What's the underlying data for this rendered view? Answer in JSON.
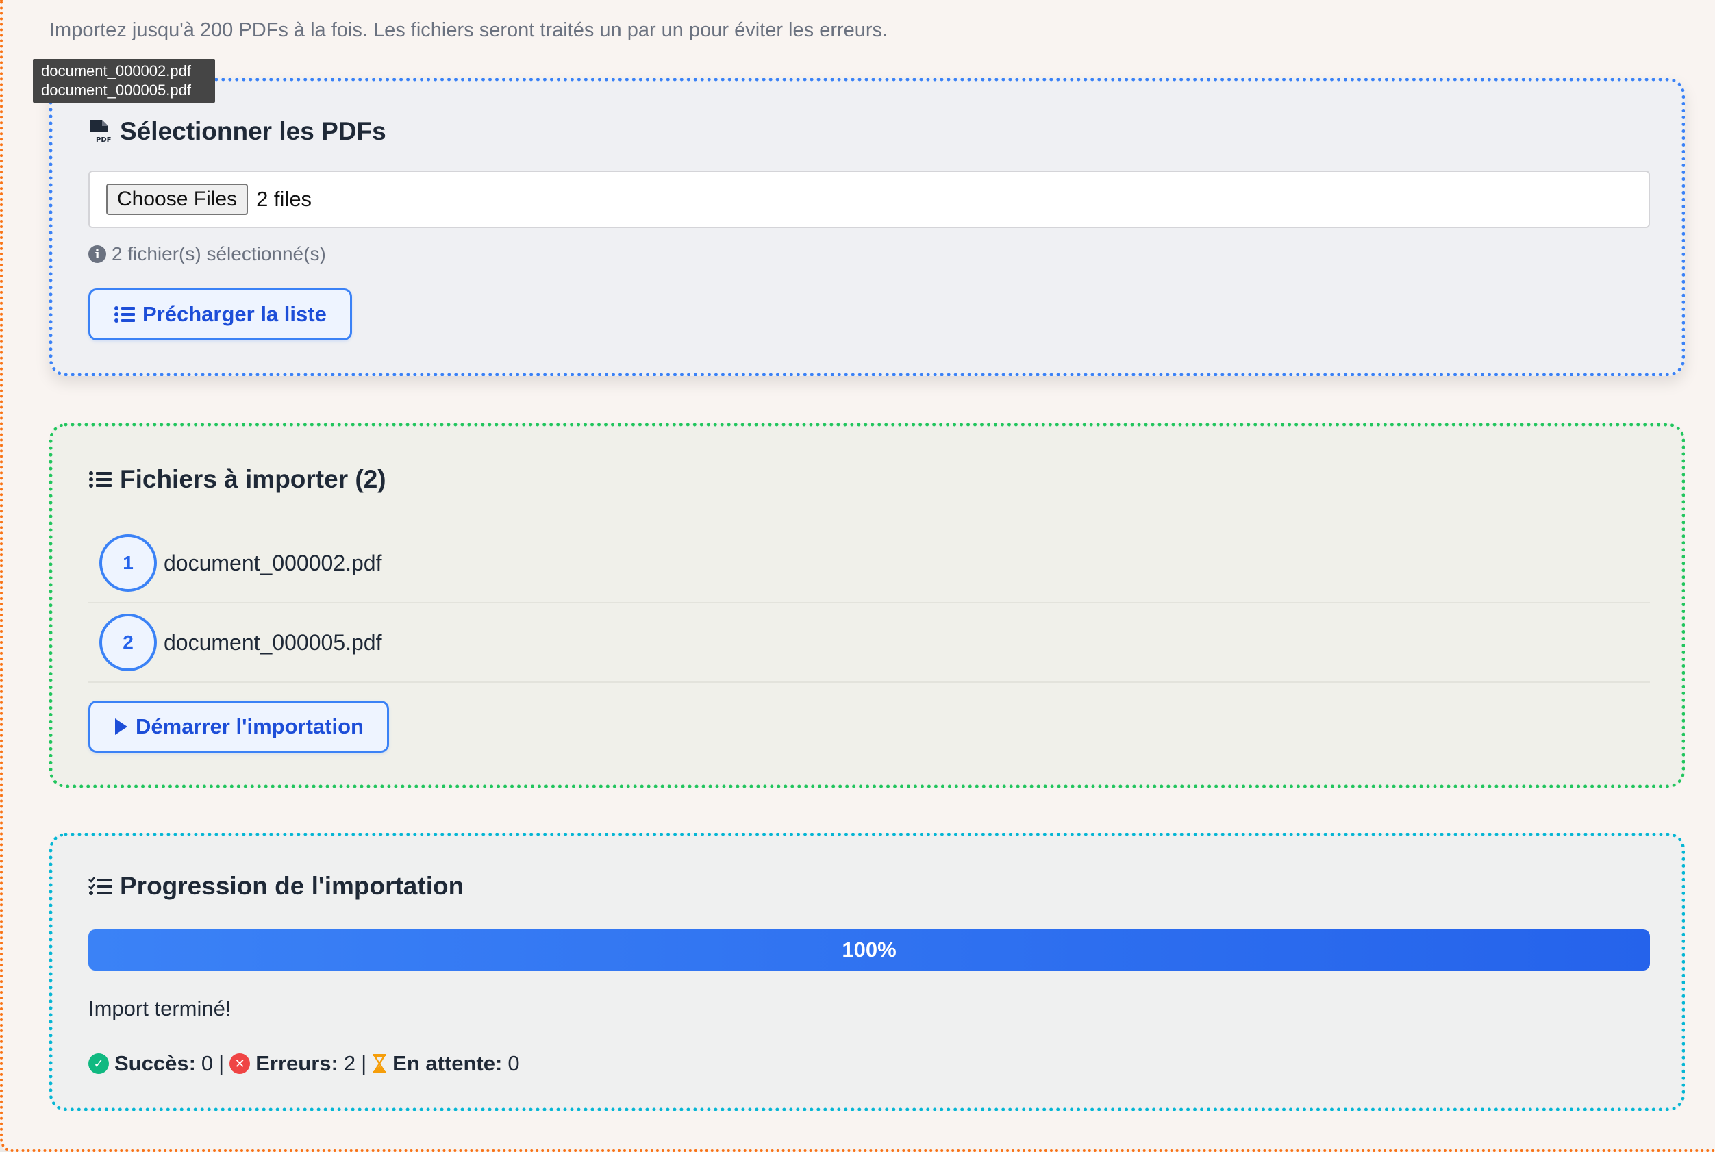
{
  "intro_text": "Importez jusqu'à 200 PDFs à la fois. Les fichiers seront traités un par un pour éviter les erreurs.",
  "tooltip": {
    "lines": [
      "document_000002.pdf",
      "document_000005.pdf"
    ]
  },
  "select_section": {
    "title": "Sélectionner les PDFs",
    "title_icon": "file-pdf-icon",
    "choose_files_label": "Choose Files",
    "file_input_value": "2 files",
    "hint": "2 fichier(s) sélectionné(s)",
    "preload_button": "Précharger la liste"
  },
  "files_section": {
    "title": "Fichiers à importer (2)",
    "title_icon": "list-icon",
    "files": [
      {
        "index": "1",
        "name": "document_000002.pdf"
      },
      {
        "index": "2",
        "name": "document_000005.pdf"
      }
    ],
    "start_button": "Démarrer l'importation"
  },
  "progress_section": {
    "title": "Progression de l'importation",
    "title_icon": "list-check-icon",
    "progress_value": 1.0,
    "progress_label": "100%",
    "status_message": "Import terminé!",
    "stats": {
      "success_label": "Succès:",
      "success_value": "0",
      "errors_label": "Erreurs:",
      "errors_value": "2",
      "pending_label": "En attente:",
      "pending_value": "0",
      "separator": "|"
    }
  },
  "colors": {
    "accent": "#3b82f6",
    "accent_dark": "#2563eb",
    "success": "#10b981",
    "error": "#ef4444",
    "pending": "#f59e0b",
    "outer_border": "#f97316",
    "files_border": "#22c55e",
    "progress_border": "#06b6d4"
  }
}
